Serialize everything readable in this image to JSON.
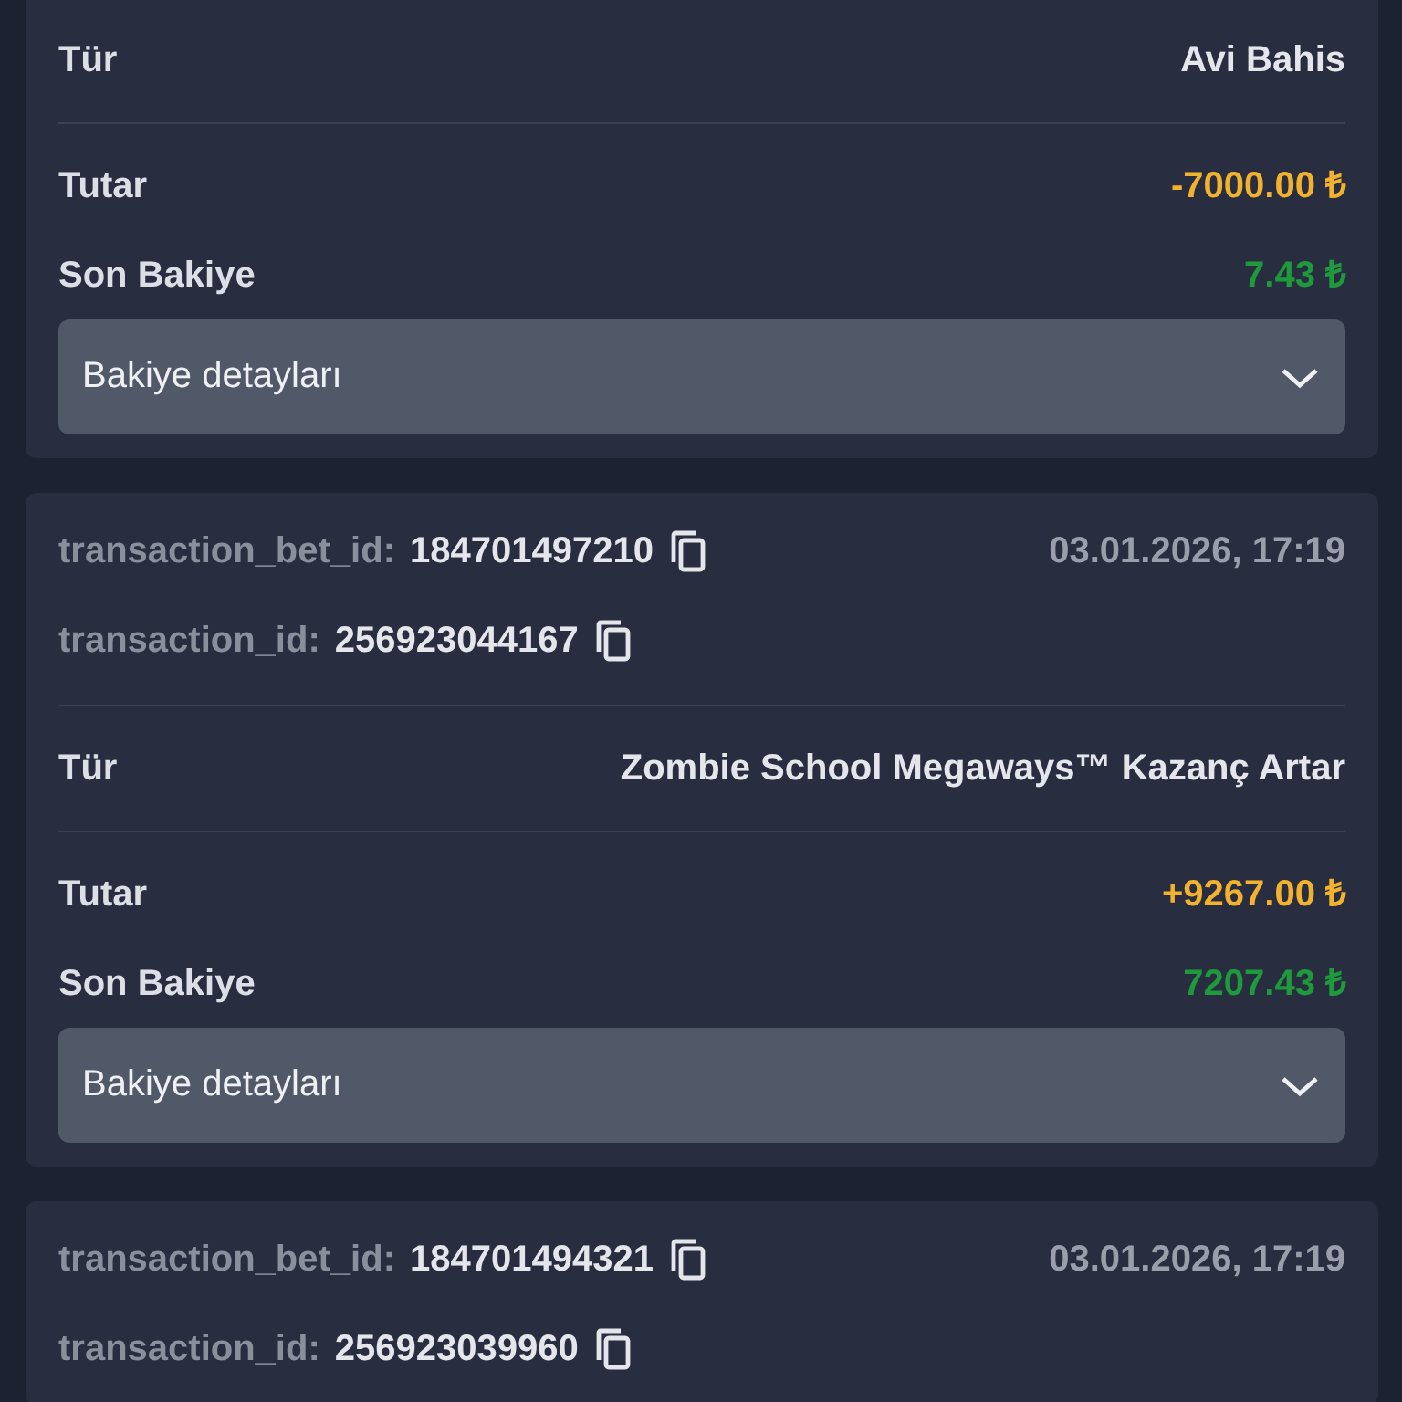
{
  "transactions": [
    {
      "type_label": "Tür",
      "type_value": "Avi Bahis",
      "amount_label": "Tutar",
      "amount": "-7000.00 ₺",
      "balance_label": "Son Bakiye",
      "balance": "7.43 ₺",
      "details": {
        "label": "Bakiye detayları",
        "expanded": false
      }
    },
    {
      "bet_id_label": "transaction_bet_id:",
      "bet_id": "184701497210",
      "date": "03.01.2026, 17:19",
      "id_label": "transaction_id:",
      "id": "256923044167",
      "type_label": "Tür",
      "type_value": "Zombie School Megaways™ Kazanç Artar",
      "amount_label": "Tutar",
      "amount": "+9267.00 ₺",
      "balance_label": "Son Bakiye",
      "balance": "7207.43 ₺",
      "details": {
        "label": "Bakiye detayları",
        "expanded": false
      }
    },
    {
      "bet_id_label": "transaction_bet_id:",
      "bet_id": "184701494321",
      "date": "03.01.2026, 17:19",
      "id_label": "transaction_id:",
      "id": "256923039960"
    }
  ]
}
